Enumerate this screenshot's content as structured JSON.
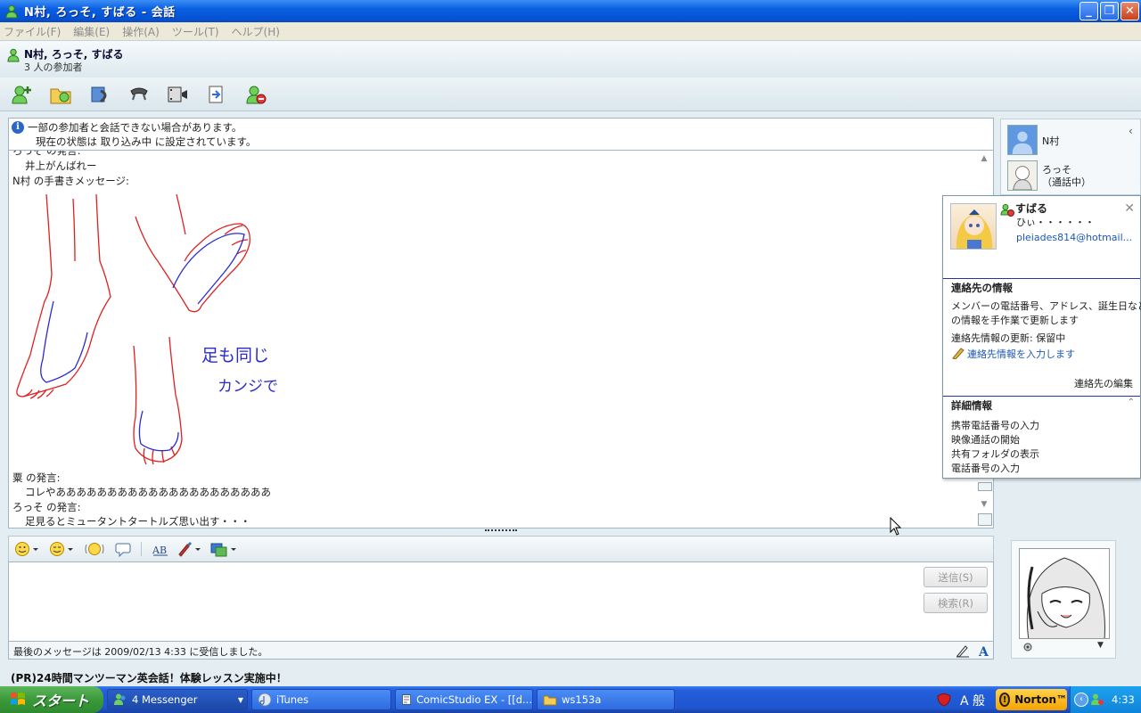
{
  "window": {
    "title": "N村, ろっそ, すばる - 会話"
  },
  "menu": [
    "ファイル(F)",
    "編集(E)",
    "操作(A)",
    "ツール(T)",
    "ヘルプ(H)"
  ],
  "header": {
    "title": "N村, ろっそ, すばる",
    "subtitle": "3 人の参加者"
  },
  "info": {
    "line1": "一部の参加者と会話できない場合があります。",
    "line2": "現在の状態は 取り込み中 に設定されています。"
  },
  "history": {
    "top_partial": "ろっそ の発言:",
    "msg1": "井上がんばれー",
    "ink_header": "N村 の手書きメッセージ:",
    "ink_text_line1": "足も同じ",
    "ink_text_line2": "カンジで",
    "speaker2": "粟 の発言:",
    "msg2": "コレやあああああああああああああああああああああ",
    "speaker3": "ろっそ の発言:",
    "msg3": "足見るとミュータントタートルズ思い出す・・・"
  },
  "buttons": {
    "send": "送信(S)",
    "search": "検索(R)"
  },
  "status": {
    "last_message": "最後のメッセージは 2009/02/13 4:33 に受信しました。"
  },
  "ad": {
    "text": "(PR)24時間マンツーマン英会話！体験レッスン実施中！"
  },
  "participants": [
    {
      "name": "N村",
      "status": ""
    },
    {
      "name": "ろっそ",
      "status": "（通話中）"
    }
  ],
  "card": {
    "name": "すばる",
    "status": "ひぃ・・・・・・",
    "email": "pleiades814@hotmail...",
    "contact_section": "連絡先の情報",
    "desc1": "メンバーの電話番号、アドレス、誕生日など",
    "desc2": "の情報を手作業で更新します",
    "update_status": "連絡先情報の更新: 保留中",
    "enter_link": "連絡先情報を入力します",
    "edit_link": "連絡先の編集",
    "detail_section": "詳細情報",
    "details": [
      "携帯電話番号の入力",
      "映像通話の開始",
      "共有フォルダの表示",
      "電話番号の入力"
    ]
  },
  "taskbar": {
    "start": "スタート",
    "tasks": [
      "4 Messenger",
      "iTunes",
      "ComicStudio EX - [[d...",
      "ws153a"
    ],
    "ime": "A 般",
    "norton": "Norton™",
    "clock": "4:33"
  }
}
